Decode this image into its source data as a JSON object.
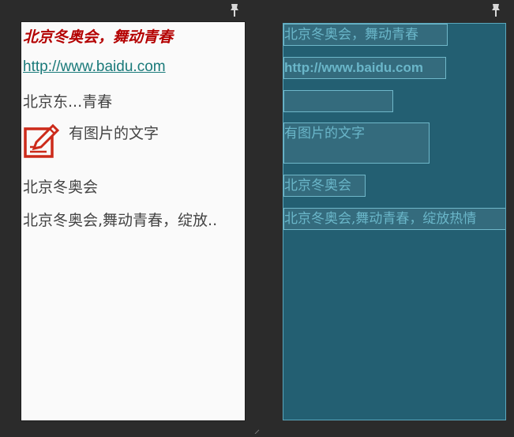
{
  "design_preview": {
    "title": "北京冬奥会，舞动青春",
    "link": "http://www.baidu.com",
    "ellipsis_text": "北京东...青春",
    "image_text": "有图片的文字",
    "image_icon": "edit-note-icon",
    "plain_text": "北京冬奥会",
    "marquee_text": "北京冬奥会,舞动青春，绽放.."
  },
  "blueprint": {
    "title": "北京冬奥会，舞动青春",
    "link": "http://www.baidu.com",
    "ellipsis_text": "",
    "image_text": "有图片的文字",
    "plain_text": "北京冬奥会",
    "marquee_text": "北京冬奥会,舞动青春，绽放热情"
  },
  "colors": {
    "background": "#2b2b2b",
    "design_bg": "#fafafa",
    "title_color": "#b40000",
    "link_color": "#1a7a7a",
    "text_color": "#444444",
    "blueprint_bg": "#235f72",
    "blueprint_text": "#6ab6c9",
    "icon_red": "#cc2a1a"
  }
}
